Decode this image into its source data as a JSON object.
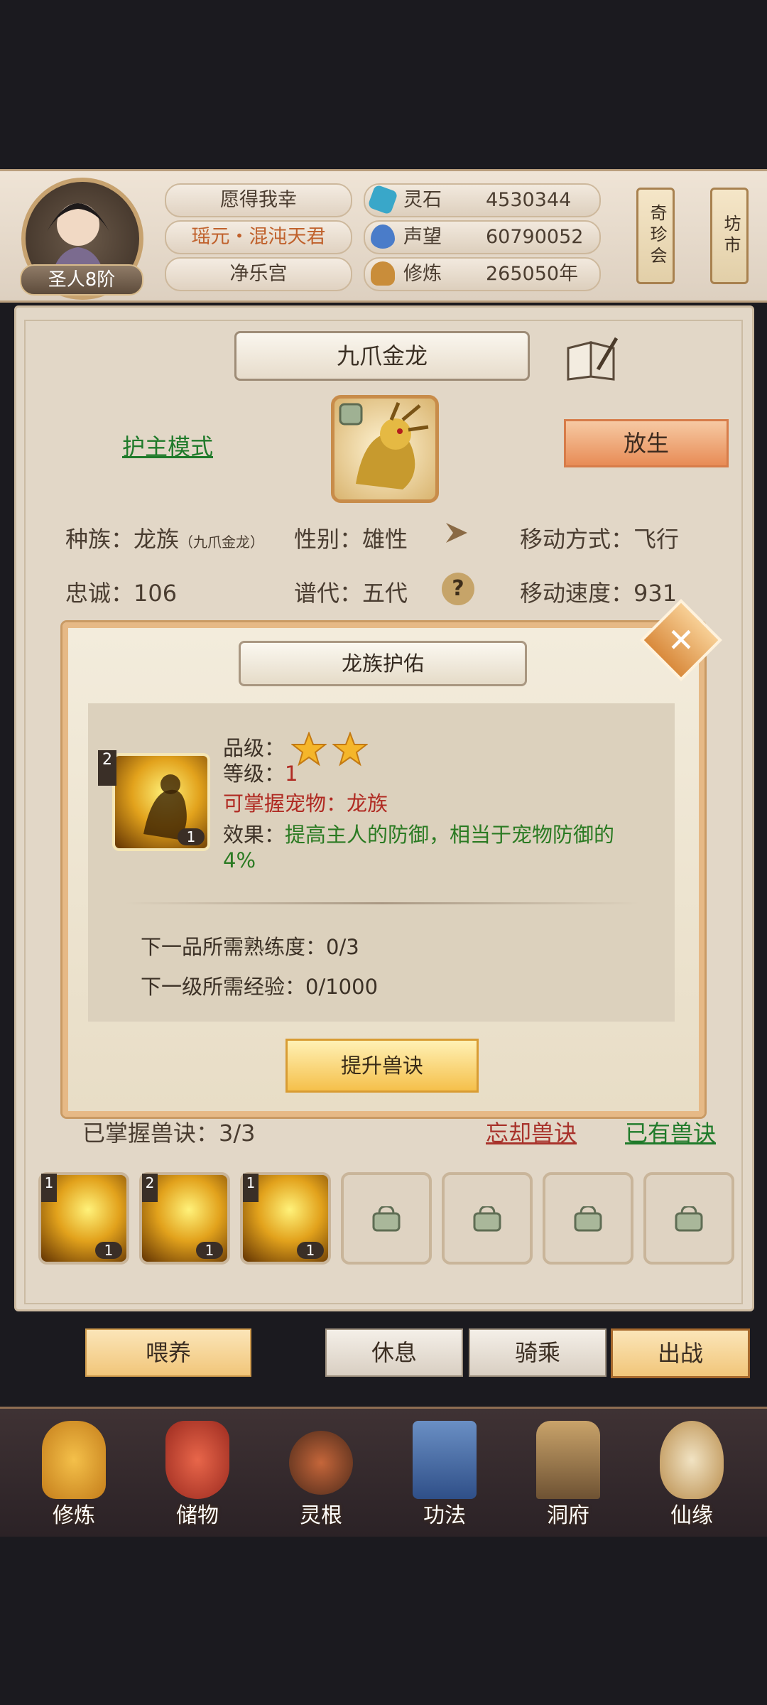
{
  "header": {
    "rank": "圣人8阶",
    "name": "愿得我幸",
    "title": "瑶元・混沌天君",
    "sect": "净乐宫",
    "resources": [
      {
        "label": "灵石",
        "value": "4530344",
        "icon": "spirit-stone-icon",
        "color": "#39a7c9"
      },
      {
        "label": "声望",
        "value": "60790052",
        "icon": "reputation-icon",
        "color": "#4a7cc9"
      },
      {
        "label": "修炼",
        "value": "265050年",
        "icon": "meditation-icon",
        "color": "#c98d3a"
      }
    ],
    "side_signs": [
      "奇珍会",
      "坊市"
    ]
  },
  "pet": {
    "name": "九爪金龙",
    "mode_link": "护主模式",
    "release_button": "放生",
    "race_label": "种族：龙族",
    "race_sub": "（九爪金龙）",
    "gender": "性别：雄性",
    "move_type": "移动方式：飞行",
    "loyalty": "忠诚：106",
    "generation": "谱代：五代",
    "move_speed": "移动速度：931",
    "help_glyph": "?"
  },
  "skills": {
    "mastered_label": "已掌握兽诀：3/3",
    "forget_link": "忘却兽诀",
    "owned_link": "已有兽诀",
    "slots": [
      {
        "grade": "1",
        "level": "1",
        "locked": false
      },
      {
        "grade": "2",
        "level": "1",
        "locked": false
      },
      {
        "grade": "1",
        "level": "1",
        "locked": false
      },
      {
        "locked": true
      },
      {
        "locked": true
      },
      {
        "locked": true
      },
      {
        "locked": true
      }
    ]
  },
  "actions": {
    "feed": "喂养",
    "rest": "休息",
    "ride": "骑乘",
    "battle": "出战"
  },
  "dialog": {
    "title": "龙族护佑",
    "grade_label": "品级：",
    "stars": 2,
    "level_label": "等级：",
    "level_value": "1",
    "pet_type": "可掌握宠物：龙族",
    "effect_label": "效果：",
    "effect_text": "提高主人的防御，相当于宠物防御的",
    "effect_tail": "4%",
    "icon_grade": "2",
    "icon_level": "1",
    "next_grade": "下一品所需熟练度：0/3",
    "next_level": "下一级所需经验：0/1000",
    "upgrade_button": "提升兽诀",
    "close_glyph": "✕"
  },
  "nav": [
    {
      "label": "修炼",
      "icon": "cultivation-icon"
    },
    {
      "label": "储物",
      "icon": "storage-bag-icon"
    },
    {
      "label": "灵根",
      "icon": "spirit-root-icon"
    },
    {
      "label": "功法",
      "icon": "technique-book-icon"
    },
    {
      "label": "洞府",
      "icon": "cave-palace-icon"
    },
    {
      "label": "仙缘",
      "icon": "immortal-fate-icon"
    }
  ]
}
